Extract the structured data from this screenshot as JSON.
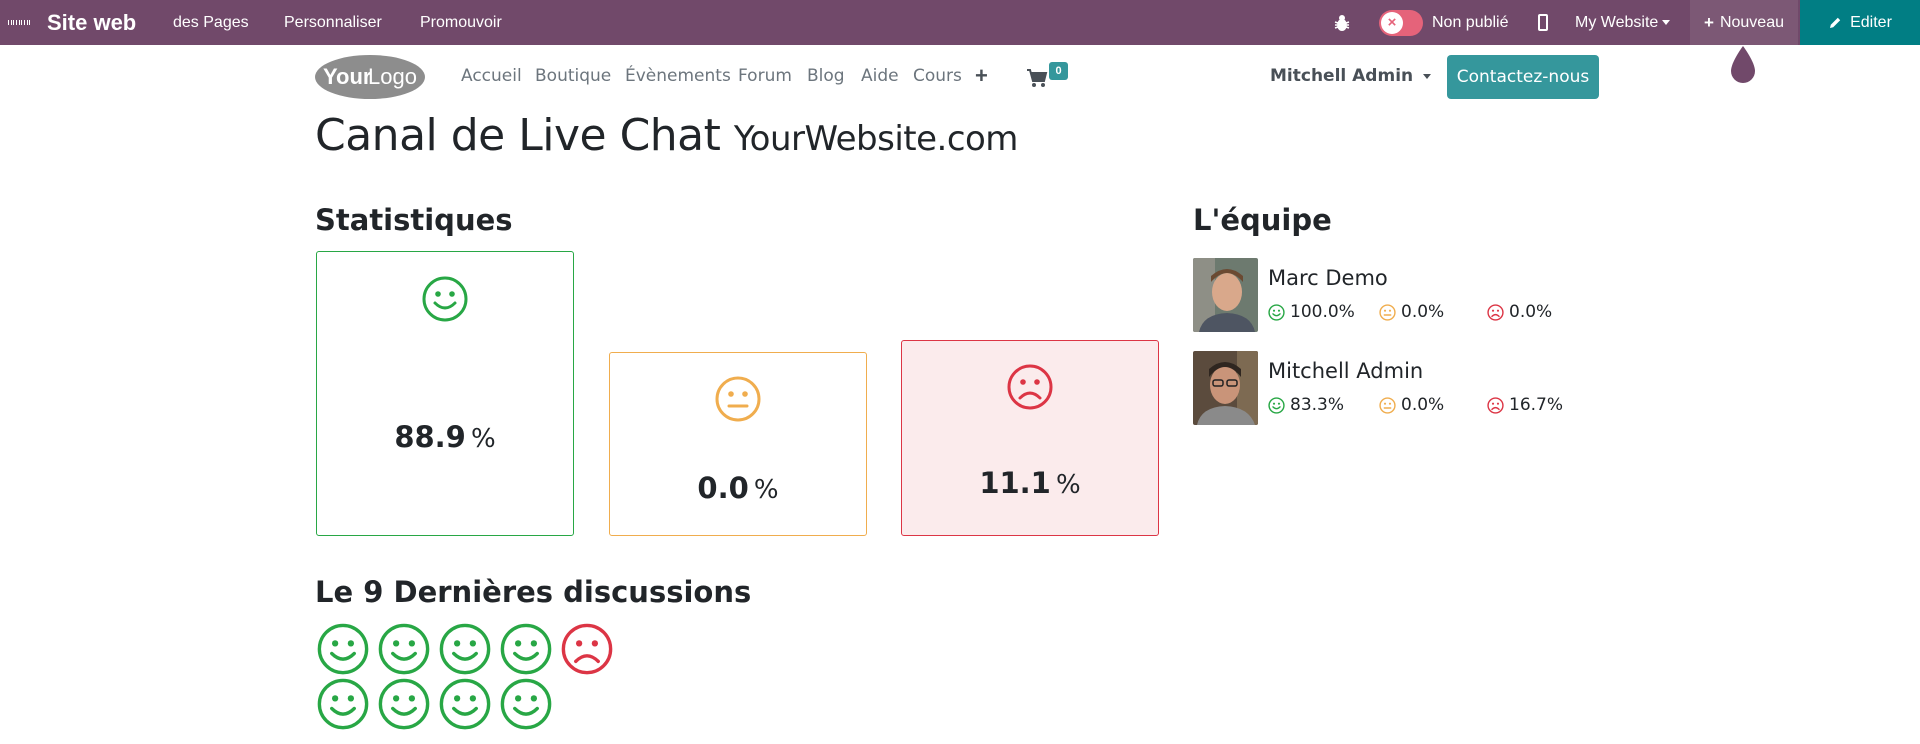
{
  "adminbar": {
    "brand": "Site web",
    "menus": [
      "des Pages",
      "Personnaliser",
      "Promouvoir"
    ],
    "publish_status": "Non publié",
    "website_selector": "My Website",
    "new_label": "Nouveau",
    "edit_label": "Editer"
  },
  "header": {
    "logo_text_bold": "Your",
    "logo_text_light": "Logo",
    "nav": [
      "Accueil",
      "Boutique",
      "Évènements",
      "Forum",
      "Blog",
      "Aide",
      "Cours"
    ],
    "cart_count": "0",
    "user": "Mitchell Admin",
    "contact_label": "Contactez-nous"
  },
  "page": {
    "title": "Canal de Live Chat",
    "site": "YourWebsite.com"
  },
  "stats": {
    "title": "Statistiques",
    "cards": [
      {
        "kind": "satisfied",
        "value": "88.9",
        "unit": "%"
      },
      {
        "kind": "neutral",
        "value": "0.0",
        "unit": "%"
      },
      {
        "kind": "unsatisfied",
        "value": "11.1",
        "unit": "%"
      }
    ]
  },
  "team": {
    "title": "L'équipe",
    "members": [
      {
        "name": "Marc Demo",
        "satisfied": "100.0%",
        "neutral": "0.0%",
        "unsatisfied": "0.0%"
      },
      {
        "name": "Mitchell Admin",
        "satisfied": "83.3%",
        "neutral": "0.0%",
        "unsatisfied": "16.7%"
      }
    ]
  },
  "discussions": {
    "title": "Le 9 Dernières discussions",
    "ratings": [
      "satisfied",
      "satisfied",
      "satisfied",
      "satisfied",
      "unsatisfied",
      "satisfied",
      "satisfied",
      "satisfied",
      "satisfied"
    ]
  },
  "colors": {
    "adminbar": "#71496a",
    "edit": "#017e84",
    "primary": "#35979c",
    "good": "#28a745",
    "neutral": "#f0ad4e",
    "bad": "#dc3545"
  },
  "icons": {
    "apps": "apps-grid-icon",
    "debug": "bug-icon",
    "mobile": "mobile-icon",
    "cart": "shopping-cart-icon",
    "edit": "pencil-icon",
    "new": "plus-icon"
  }
}
